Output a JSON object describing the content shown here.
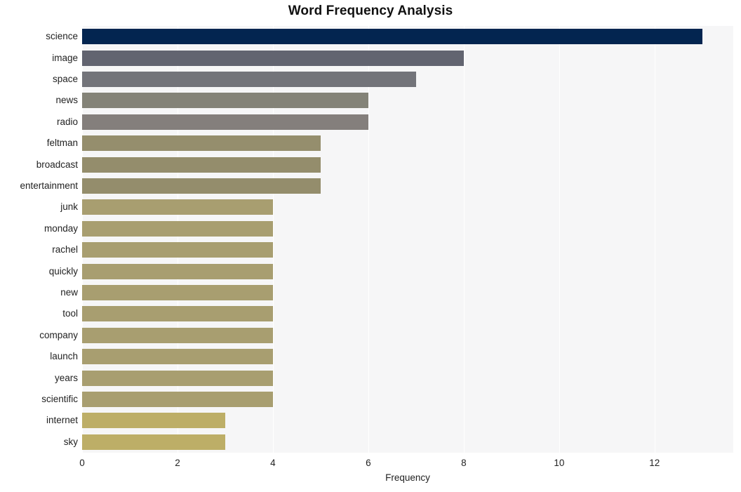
{
  "chart_data": {
    "type": "bar",
    "orientation": "horizontal",
    "title": "Word Frequency Analysis",
    "xlabel": "Frequency",
    "ylabel": "",
    "categories": [
      "science",
      "image",
      "space",
      "news",
      "radio",
      "feltman",
      "broadcast",
      "entertainment",
      "junk",
      "monday",
      "rachel",
      "quickly",
      "new",
      "tool",
      "company",
      "launch",
      "years",
      "scientific",
      "internet",
      "sky"
    ],
    "values": [
      13,
      8,
      7,
      6,
      6,
      5,
      5,
      5,
      4,
      4,
      4,
      4,
      4,
      4,
      4,
      4,
      4,
      4,
      3,
      3
    ],
    "bar_colors": [
      "#032550",
      "#626470",
      "#73747a",
      "#848378",
      "#847f7c",
      "#958e6d",
      "#948d6c",
      "#948d6c",
      "#a89e70",
      "#a89e70",
      "#a89e70",
      "#a89e70",
      "#a89e70",
      "#a89e70",
      "#a89e70",
      "#a89e70",
      "#a89e70",
      "#a89e70",
      "#bdae67",
      "#bdae67"
    ],
    "xlim": [
      0,
      13.65
    ],
    "x_ticks": [
      0,
      2,
      4,
      6,
      8,
      10,
      12
    ],
    "x_tick_labels": [
      "0",
      "2",
      "4",
      "6",
      "8",
      "10",
      "12"
    ],
    "grid": true,
    "grid_axis": "x",
    "legend": null,
    "plot_background": "#f6f6f7",
    "figure_background": "#ffffff",
    "gridline_color": "#ffffff",
    "text_color": "#222222",
    "title_color": "#111111"
  }
}
